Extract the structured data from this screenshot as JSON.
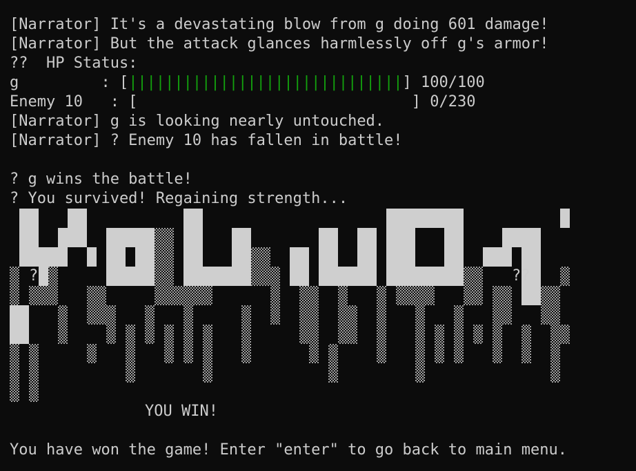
{
  "colors": {
    "background": "#0c0c0c",
    "text": "#cccccc",
    "hp_bar": "#13a10e"
  },
  "log": {
    "line1": "[Narrator] It's a devastating blow from g doing 601 damage!",
    "line2": "[Narrator] But the attack glances harmlessly off g's armor!",
    "hp_header": "??  HP Status:",
    "player_name": "g         : [",
    "player_bar": "||||||||||||||||||||||||||||||",
    "player_bar_end": "] 100/100",
    "enemy_name": "Enemy 10   : [",
    "enemy_bar": "                              ",
    "enemy_bar_end": "] 0/230",
    "line3": "[Narrator] g is looking nearly untouched.",
    "line4": "[Narrator] ? Enemy 10 has fallen in battle!",
    "line5": "? g wins the battle!",
    "line6": "? You survived! Regaining strength..."
  },
  "art": {
    "left_mark": "?",
    "right_mark": "??"
  },
  "footer": {
    "you_win": "YOU WIN!",
    "prompt": "You have won the game! Enter \"enter\" to go back to main menu."
  }
}
